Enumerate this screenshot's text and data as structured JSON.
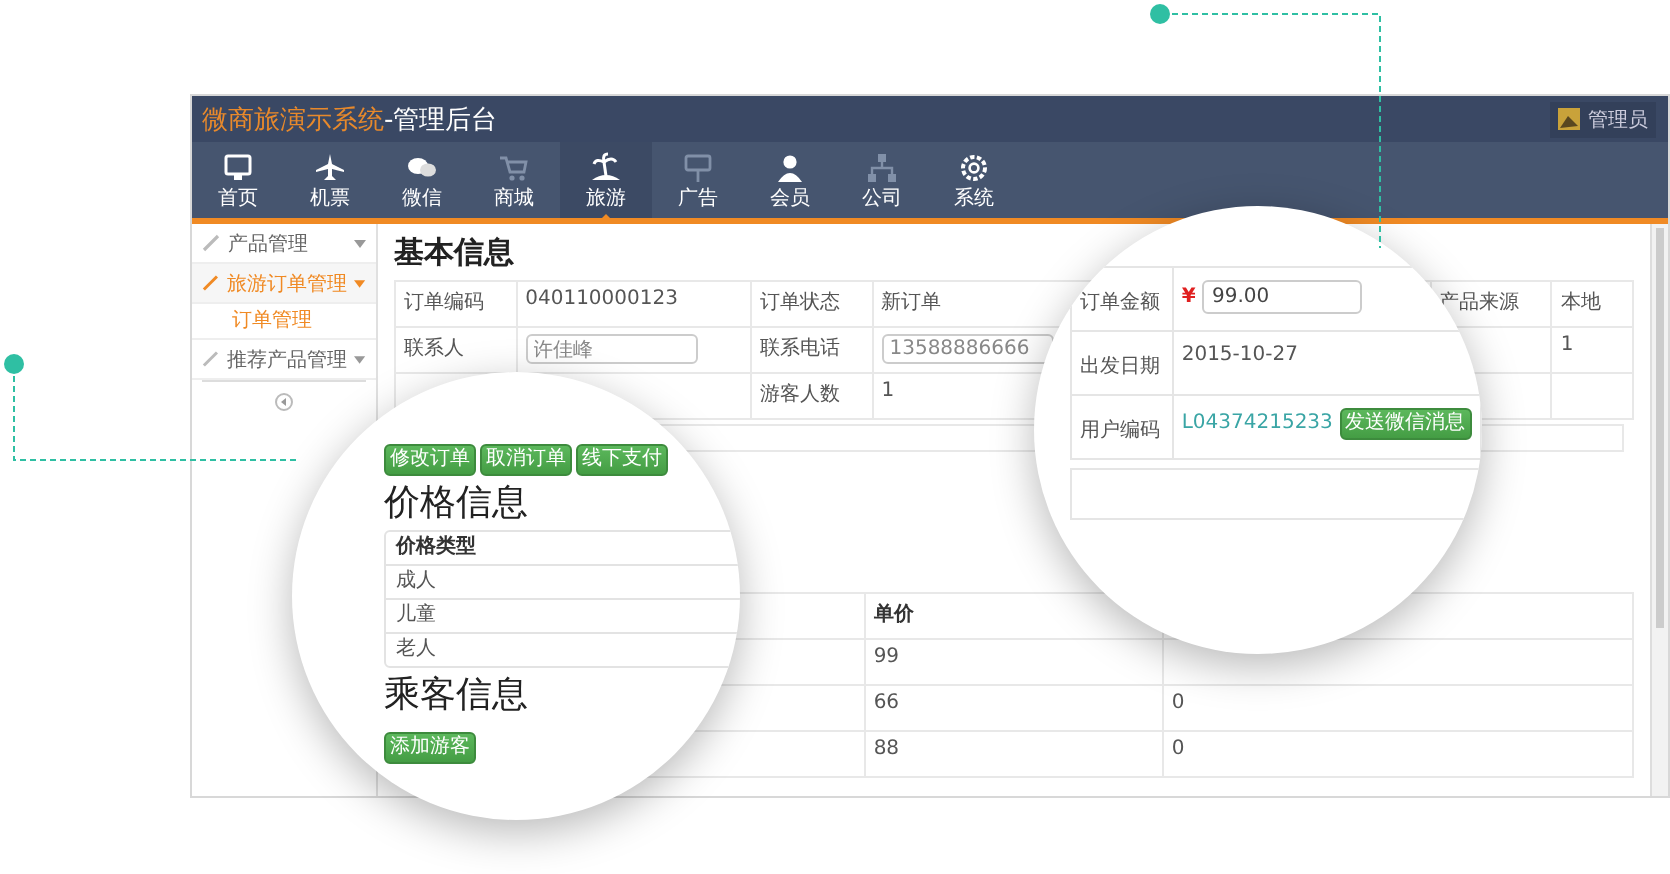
{
  "window": {
    "brand": "微商旅演示系统",
    "suffix": "-管理后台",
    "user": "管理员"
  },
  "nav": [
    {
      "label": "首页",
      "selected": false
    },
    {
      "label": "机票",
      "selected": false
    },
    {
      "label": "微信",
      "selected": false
    },
    {
      "label": "商城",
      "selected": false
    },
    {
      "label": "旅游",
      "selected": true
    },
    {
      "label": "广告",
      "selected": false
    },
    {
      "label": "会员",
      "selected": false
    },
    {
      "label": "公司",
      "selected": false
    },
    {
      "label": "系统",
      "selected": false
    }
  ],
  "sidebar": [
    {
      "label": "产品管理",
      "expanded": false
    },
    {
      "label": "旅游订单管理",
      "expanded": true,
      "children": [
        {
          "label": "订单管理",
          "selected": true
        }
      ]
    },
    {
      "label": "推荐产品管理",
      "expanded": false
    }
  ],
  "basic_info": {
    "heading": "基本信息",
    "rows": [
      [
        {
          "kind": "label",
          "text": "订单编码"
        },
        {
          "kind": "value",
          "text": "040110000123"
        },
        {
          "kind": "label",
          "text": "订单状态"
        },
        {
          "kind": "value",
          "text": "新订单"
        },
        {
          "kind": "blank"
        },
        {
          "kind": "blank"
        },
        {
          "kind": "label",
          "text": "产品来源"
        },
        {
          "kind": "value",
          "text": "本地"
        }
      ],
      [
        {
          "kind": "label",
          "text": "联系人"
        },
        {
          "kind": "input",
          "text": "许佳峰"
        },
        {
          "kind": "label",
          "text": "联系电话"
        },
        {
          "kind": "input",
          "text": "13588886666"
        },
        {
          "kind": "blank"
        },
        {
          "kind": "blank"
        },
        {
          "kind": "blank"
        },
        {
          "kind": "value",
          "text": "1"
        }
      ],
      [
        {
          "kind": "blank"
        },
        {
          "kind": "blank"
        },
        {
          "kind": "label",
          "text": "游客人数"
        },
        {
          "kind": "value",
          "text": "1"
        },
        {
          "kind": "blank"
        },
        {
          "kind": "blank"
        },
        {
          "kind": "blank"
        },
        {
          "kind": "blank"
        }
      ]
    ]
  },
  "price_table": {
    "columns": [
      {
        "kind": "blank"
      },
      {
        "kind": "label",
        "text": "单价"
      },
      {
        "kind": "blank"
      }
    ],
    "rows": [
      [
        {
          "kind": "blank"
        },
        {
          "kind": "value",
          "text": "99"
        },
        {
          "kind": "blank"
        }
      ],
      [
        {
          "kind": "blank"
        },
        {
          "kind": "value",
          "text": "66"
        },
        {
          "kind": "value",
          "text": "0"
        }
      ],
      [
        {
          "kind": "blank"
        },
        {
          "kind": "value",
          "text": "88"
        },
        {
          "kind": "value",
          "text": "0"
        }
      ]
    ]
  },
  "zoom_left": {
    "buttons": [
      "修改订单",
      "取消订单",
      "线下支付"
    ],
    "price_heading": "价格信息",
    "price_header": "价格类型",
    "price_rows": [
      "成人",
      "儿童",
      "老人"
    ],
    "passenger_heading": "乘客信息",
    "add_button": "添加游客"
  },
  "zoom_right": {
    "rows": [
      {
        "label": "订单金额",
        "kind": "price",
        "currency": "¥",
        "value": "99.00"
      },
      {
        "label": "出发日期",
        "kind": "text",
        "value": "2015-10-27"
      },
      {
        "label": "用户编码",
        "kind": "link",
        "value": "L04374215233",
        "button": "发送微信消息"
      }
    ]
  }
}
